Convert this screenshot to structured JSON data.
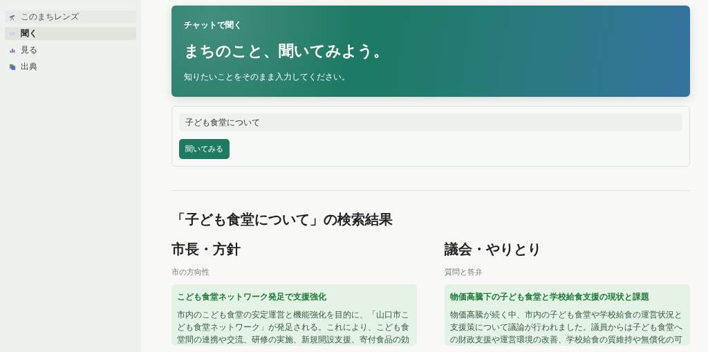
{
  "sidebar": {
    "brand": "このまちレンズ",
    "items": [
      {
        "label": "聞く",
        "kind": "ask",
        "selected": true
      },
      {
        "label": "見る",
        "kind": "view",
        "selected": false
      },
      {
        "label": "出典",
        "kind": "source",
        "selected": false
      }
    ]
  },
  "hero": {
    "eyebrow": "チャットで聞く",
    "title": "まちのこと、聞いてみよう。",
    "subtitle": "知りたいことをそのまま入力してください。"
  },
  "search": {
    "value": "子ども食堂について",
    "button": "聞いてみる"
  },
  "results": {
    "heading": "「子ども食堂について」の検索結果",
    "sections": [
      {
        "title": "市長・方針",
        "subtitle": "市の方向性",
        "card": {
          "title": "こども食堂ネットワーク発足で支援強化",
          "body": "市内のこども食堂の安定運営と機能強化を目的に、「山口市こども食堂ネットワーク」が発足される。これにより、こども食堂間の連携や交流、研修の実施、新規開設支援、寄付食品の効"
        }
      },
      {
        "title": "議会・やりとり",
        "subtitle": "質問と答弁",
        "card": {
          "title": "物価高騰下の子ども食堂と学校給食支援の現状と課題",
          "body": "物価高騰が続く中、市内の子ども食堂や学校給食の運営状況と支援策について議論が行われました。議員からは子ども食堂への財政支援や運営環境の改善、学校給食の質維持や無償化の可"
        }
      }
    ]
  }
}
